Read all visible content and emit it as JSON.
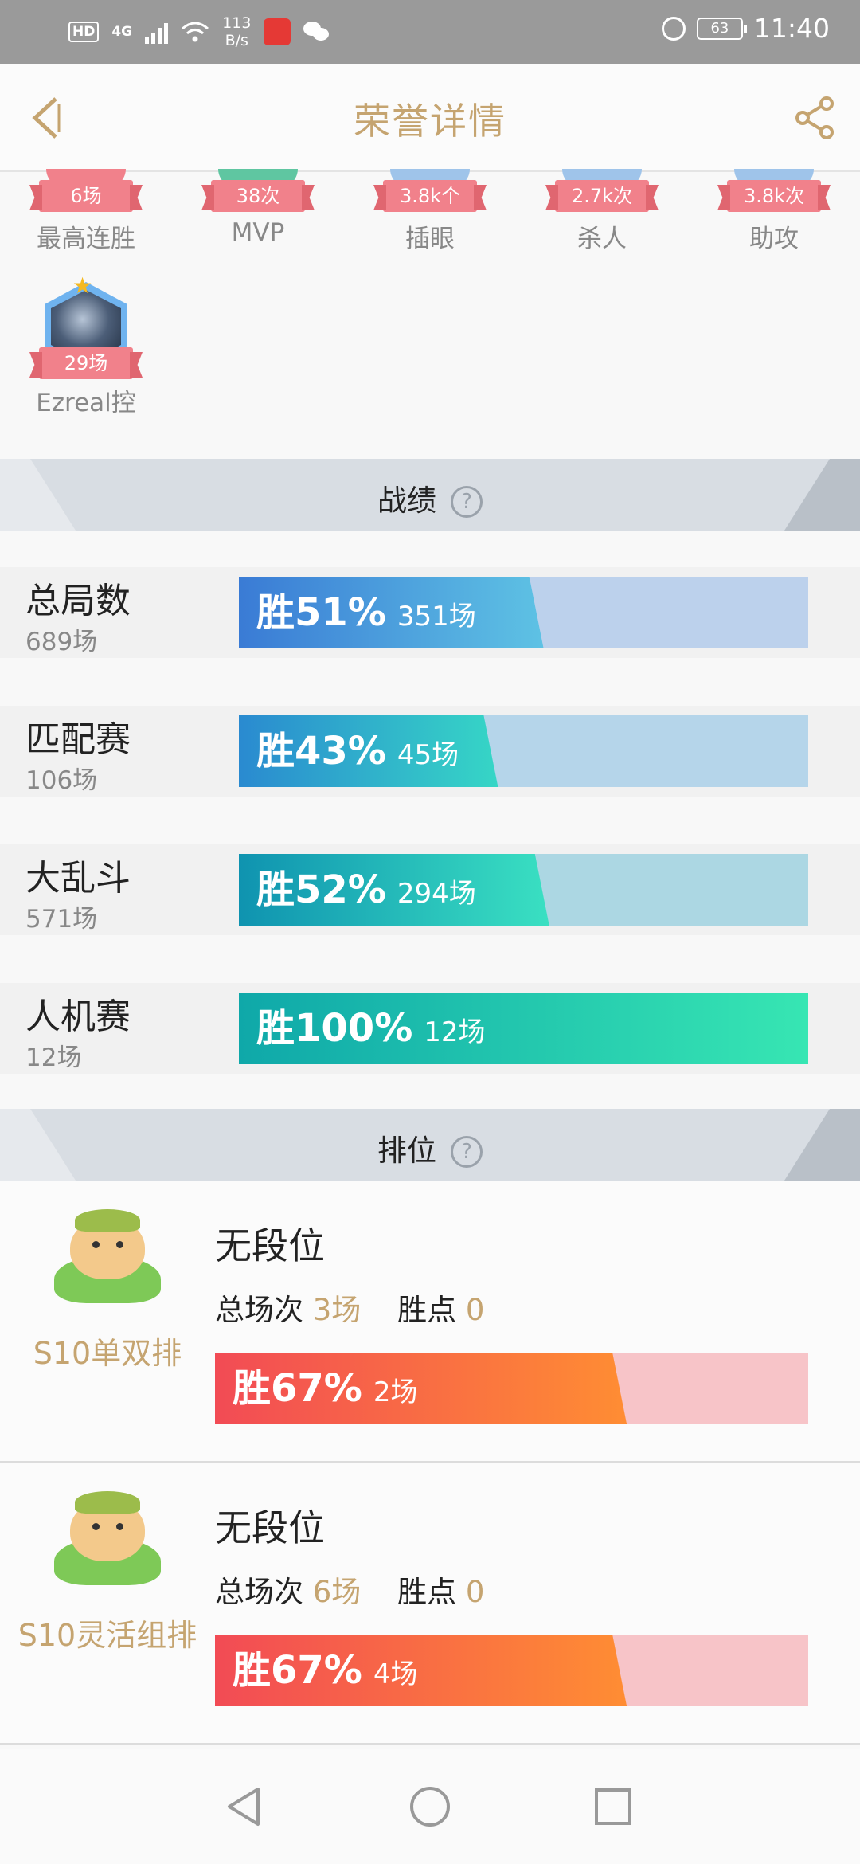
{
  "status_bar": {
    "badge": "HD",
    "network": "4G",
    "speed_value": "113",
    "speed_unit": "B/s",
    "battery": "63",
    "time": "11:40"
  },
  "header": {
    "title": "荣誉详情"
  },
  "honors": [
    {
      "count": "6场",
      "label": "最高连胜",
      "color": "#f1818b"
    },
    {
      "count": "38次",
      "label": "MVP",
      "color": "#5fc6a1"
    },
    {
      "count": "3.8k个",
      "label": "插眼",
      "color": "#9fc4ea"
    },
    {
      "count": "2.7k次",
      "label": "杀人",
      "color": "#9fc4ea"
    },
    {
      "count": "3.8k次",
      "label": "助攻",
      "color": "#9fc4ea"
    }
  ],
  "hero_honor": {
    "count": "29场",
    "label": "Ezreal控"
  },
  "records_section": {
    "title": "战绩",
    "help": "?"
  },
  "records": [
    {
      "name": "总局数",
      "total": "689场",
      "win_pct": "胜51%",
      "win_games": "351场",
      "win_rate": 0.51,
      "fill_from": "#3a7bd5",
      "fill_to": "#5ec2e4",
      "track": "#bcd1ec"
    },
    {
      "name": "匹配赛",
      "total": "106场",
      "win_pct": "胜43%",
      "win_games": "45场",
      "win_rate": 0.43,
      "fill_from": "#2a8ad0",
      "fill_to": "#36d6c6",
      "track": "#b5d5ea"
    },
    {
      "name": "大乱斗",
      "total": "571场",
      "win_pct": "胜52%",
      "win_games": "294场",
      "win_rate": 0.52,
      "fill_from": "#0f93b0",
      "fill_to": "#3ae0c2",
      "track": "#acd7e3"
    },
    {
      "name": "人机赛",
      "total": "12场",
      "win_pct": "胜100%",
      "win_games": "12场",
      "win_rate": 1.0,
      "fill_from": "#0fa8a9",
      "fill_to": "#37e6b3",
      "track": "#a8e0d6"
    }
  ],
  "ranked_section": {
    "title": "排位",
    "help": "?"
  },
  "ranked": [
    {
      "queue": "S10单双排",
      "tier": "无段位",
      "total_label": "总场次",
      "total": "3场",
      "points_label": "胜点",
      "points": "0",
      "win_pct": "胜67%",
      "win_games": "2场",
      "win_rate": 0.67
    },
    {
      "queue": "S10灵活组排",
      "tier": "无段位",
      "total_label": "总场次",
      "total": "6场",
      "points_label": "胜点",
      "points": "0",
      "win_pct": "胜67%",
      "win_games": "4场",
      "win_rate": 0.67
    }
  ],
  "nav": {
    "back": "back-triangle-icon",
    "home": "home-circle-icon",
    "recents": "recents-square-icon"
  }
}
